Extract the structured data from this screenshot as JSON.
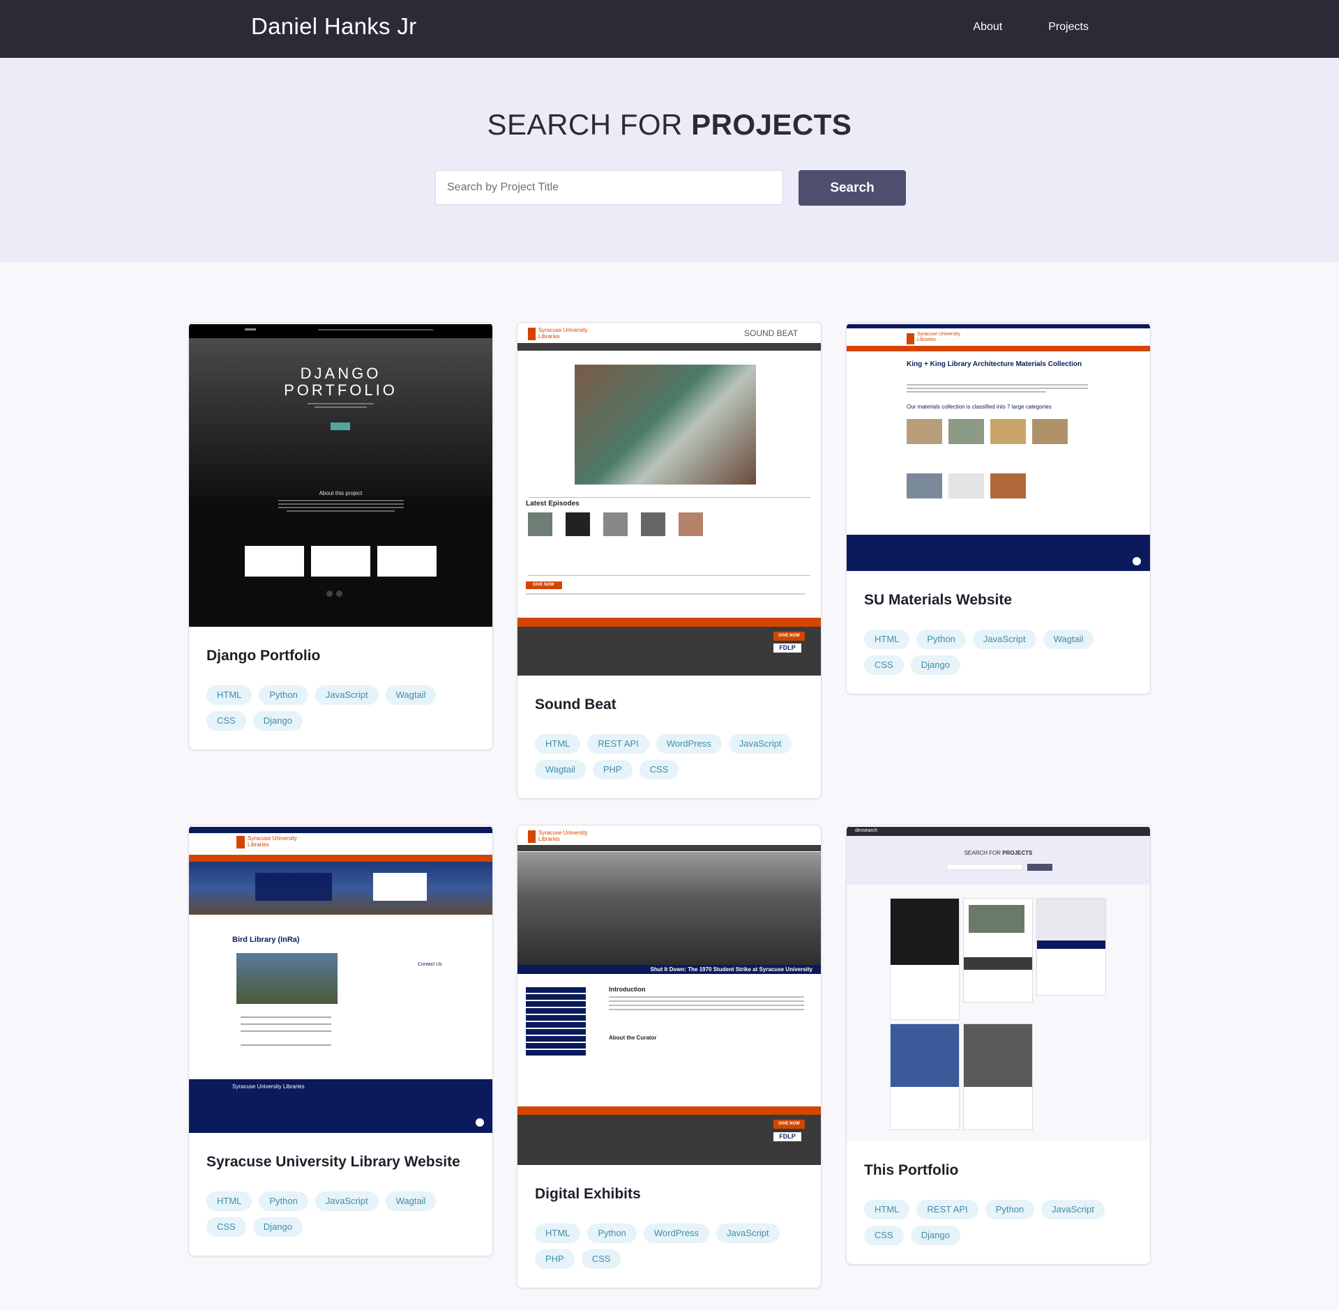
{
  "navbar": {
    "brand": "Daniel Hanks Jr",
    "links": [
      "About",
      "Projects"
    ]
  },
  "hero": {
    "title_light": "SEARCH FOR ",
    "title_bold": "PROJECTS",
    "search_placeholder": "Search by Project Title",
    "search_button": "Search"
  },
  "projects": [
    {
      "title": "Django Portfolio",
      "tags": [
        "HTML",
        "Python",
        "JavaScript",
        "Wagtail",
        "CSS",
        "Django"
      ],
      "thumb": {
        "heading_1": "DJANGO",
        "heading_2": "PORTFOLIO",
        "section": "About this project"
      }
    },
    {
      "title": "Sound Beat",
      "tags": [
        "HTML",
        "REST API",
        "WordPress",
        "JavaScript",
        "Wagtail",
        "PHP",
        "CSS"
      ],
      "thumb": {
        "logo": "Syracuse University Libraries",
        "brand": "SOUND BEAT",
        "section": "Latest Episodes",
        "give": "GIVE NOW",
        "fdlp": "FDLP"
      }
    },
    {
      "title": "SU Materials Website",
      "tags": [
        "HTML",
        "Python",
        "JavaScript",
        "Wagtail",
        "CSS",
        "Django"
      ],
      "thumb": {
        "logo": "Syracuse University Libraries",
        "heading": "King + King Library Architecture Materials Collection",
        "sub": "Our materials collection is classified into 7 large categories"
      }
    },
    {
      "title": "Syracuse University Library Website",
      "tags": [
        "HTML",
        "Python",
        "JavaScript",
        "Wagtail",
        "CSS",
        "Django"
      ],
      "thumb": {
        "logo": "Syracuse University Libraries",
        "heading": "Bird Library (InRa)",
        "contact": "Contact Us",
        "footer": "Syracuse University Libraries"
      }
    },
    {
      "title": "Digital Exhibits",
      "tags": [
        "HTML",
        "Python",
        "WordPress",
        "JavaScript",
        "PHP",
        "CSS"
      ],
      "thumb": {
        "logo": "Syracuse University Libraries",
        "banner": "Shut It Down: The 1970 Student Strike at Syracuse University",
        "intro": "Introduction",
        "curator": "About the Curator",
        "give": "GIVE NOW",
        "fdlp": "FDLP"
      }
    },
    {
      "title": "This Portfolio",
      "tags": [
        "HTML",
        "REST API",
        "Python",
        "JavaScript",
        "CSS",
        "Django"
      ],
      "thumb": {
        "brand": "devsearch",
        "heading_light": "SEARCH FOR ",
        "heading_bold": "PROJECTS"
      }
    }
  ],
  "colors": {
    "navbar": "#2b2b37",
    "hero": "#ececf9",
    "button": "#4e4f6e",
    "tag_bg": "#e6f3f9",
    "tag_text": "#3f8ea9",
    "su_orange": "#d44500",
    "su_navy": "#0a1a5c"
  }
}
